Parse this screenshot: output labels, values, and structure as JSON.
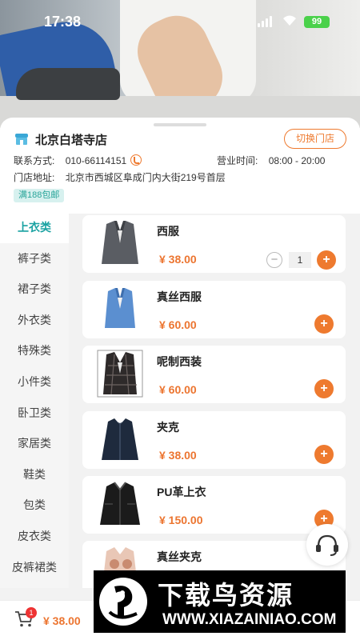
{
  "status_bar": {
    "time": "17:38",
    "battery": "99"
  },
  "store": {
    "name": "北京白塔寺店",
    "switch_label": "切换门店",
    "contact_label": "联系方式:",
    "phone": "010-66114151",
    "hours_label": "营业时间:",
    "hours": "08:00 - 20:00",
    "address_label": "门店地址:",
    "address": "北京市西城区阜成门内大街219号首层",
    "badge": "满188包邮"
  },
  "categories": [
    "上衣类",
    "裤子类",
    "裙子类",
    "外衣类",
    "特殊类",
    "小件类",
    "卧卫类",
    "家居类",
    "鞋类",
    "包类",
    "皮衣类",
    "皮裤裙类"
  ],
  "active_category": "上衣类",
  "products": [
    {
      "name": "西服",
      "price": "¥ 38.00",
      "quantity": "1"
    },
    {
      "name": "真丝西服",
      "price": "¥ 60.00"
    },
    {
      "name": "呢制西装",
      "price": "¥ 60.00"
    },
    {
      "name": "夹克",
      "price": "¥ 38.00"
    },
    {
      "name": "PU革上衣",
      "price": "¥ 150.00"
    },
    {
      "name": "真丝夹克",
      "price": ""
    }
  ],
  "controls": {
    "add_symbol": "+",
    "minus_symbol": "−"
  },
  "cart": {
    "count": "1",
    "total": "¥ 38.00"
  },
  "watermark": {
    "title": "下载鸟资源",
    "url": "WWW.XIAZAINIAO.COM"
  },
  "colors": {
    "accent": "#ee7a2f",
    "teal": "#1aa2a2"
  }
}
